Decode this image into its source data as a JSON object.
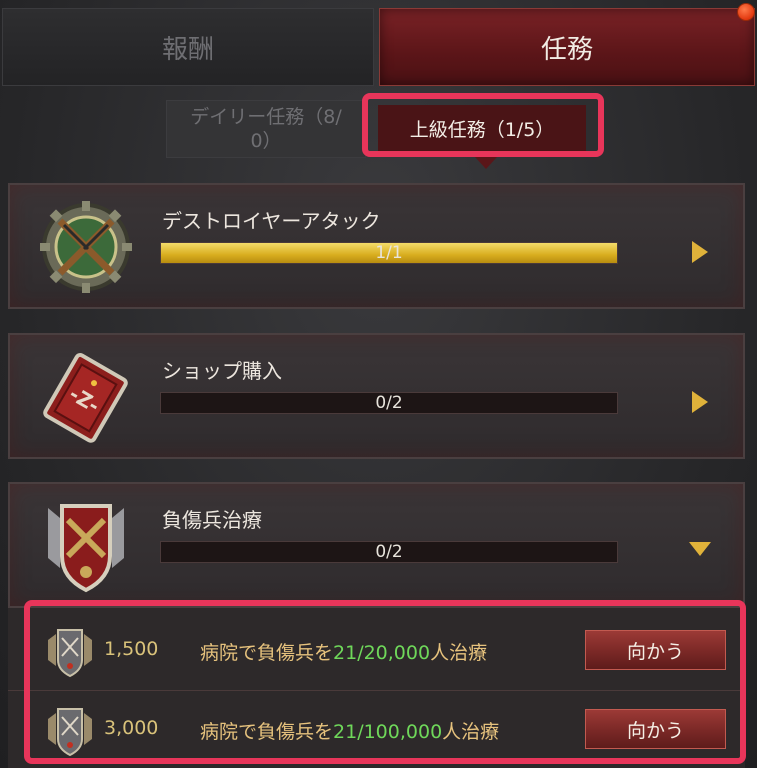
{
  "tabs": {
    "reward": "報酬",
    "task": "任務"
  },
  "subtabs": {
    "daily_line1": "デイリー任務（8/",
    "daily_line2": "0）",
    "advanced": "上級任務（1/5）"
  },
  "quests": [
    {
      "title": "デストロイヤーアタック",
      "progress_text": "1/1",
      "progress": 1.0,
      "expanded": false,
      "icon": "crossed-rifles-gear-icon"
    },
    {
      "title": "ショップ購入",
      "progress_text": "0/2",
      "progress": 0.0,
      "expanded": false,
      "icon": "red-card-icon"
    },
    {
      "title": "負傷兵治療",
      "progress_text": "0/2",
      "progress": 0.0,
      "expanded": true,
      "icon": "crossed-pistols-shield-icon"
    }
  ],
  "subquests": [
    {
      "reward": "1,500",
      "desc_prefix": "病院で負傷兵を",
      "desc_highlight": "21/20,000",
      "desc_suffix": "人治療",
      "button": "向かう",
      "icon": "rank-medal-icon"
    },
    {
      "reward": "3,000",
      "desc_prefix": "病院で負傷兵を",
      "desc_highlight": "21/100,000",
      "desc_suffix": "人治療",
      "button": "向かう",
      "icon": "rank-medal-icon"
    }
  ],
  "colors": {
    "accent_red": "#7a2226",
    "highlight_box": "#e8355a",
    "progress_gold": "#e0b23a",
    "progress_green_text": "#6fd85a"
  }
}
